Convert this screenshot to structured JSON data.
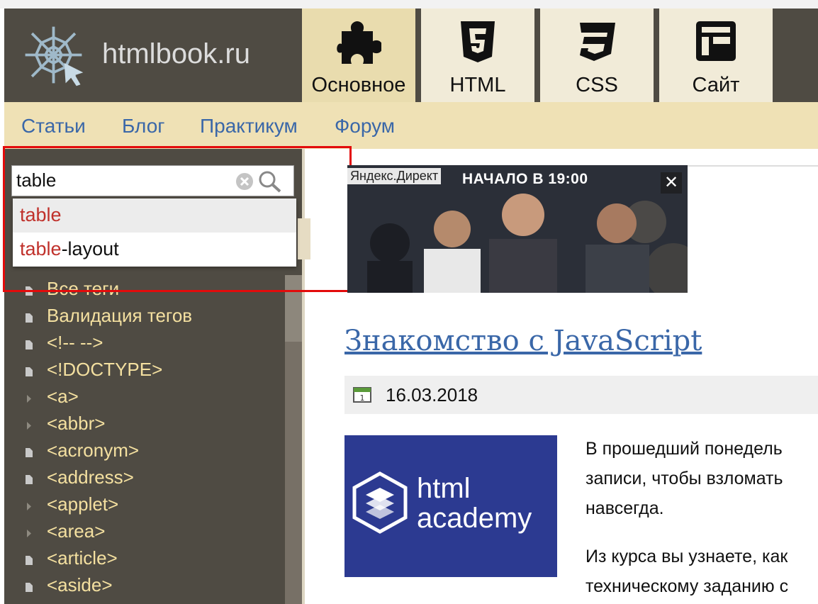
{
  "header": {
    "logo_text": "htmlbook.ru",
    "tabs": [
      {
        "label": "Основное",
        "icon": "puzzle-icon"
      },
      {
        "label": "HTML",
        "icon": "html5-icon"
      },
      {
        "label": "CSS",
        "icon": "css3-icon"
      },
      {
        "label": "Сайт",
        "icon": "layout-icon"
      }
    ],
    "active_tab": "Основное"
  },
  "subnav": {
    "items": [
      "Статьи",
      "Блог",
      "Практикум",
      "Форум"
    ]
  },
  "search": {
    "value": "table",
    "suggestions": [
      {
        "match": "table",
        "rest": ""
      },
      {
        "match": "table",
        "rest": "-layout"
      }
    ]
  },
  "sidebar": {
    "items": [
      "Все теги",
      "Валидация тегов",
      "<!-- -->",
      "<!DOCTYPE>",
      "<a>",
      "<abbr>",
      "<acronym>",
      "<address>",
      "<applet>",
      "<area>",
      "<article>",
      "<aside>"
    ],
    "item_icons": [
      "doc-icon",
      "doc-icon",
      "doc-icon",
      "doc-icon",
      "arrow-icon",
      "arrow-icon",
      "doc-icon",
      "doc-icon",
      "arrow-icon",
      "arrow-icon",
      "doc-icon",
      "doc-icon"
    ]
  },
  "ad": {
    "label": "Яндекс.Директ",
    "banner_text": "НАЧАЛО В 19:00",
    "close": "✕"
  },
  "article": {
    "title": "Знакомство с JavaScript",
    "date": "16.03.2018",
    "thumb_text_line1": "html",
    "thumb_text_line2": "academy",
    "para1_lines": [
      "В прошедший понедель",
      "записи, чтобы взломать",
      "навсегда."
    ],
    "para2_lines": [
      "Из курса вы узнаете, как",
      "техническому заданию с"
    ]
  },
  "colors": {
    "header_bg": "#4f4b43",
    "active_tab": "#e9dcae",
    "link": "#3a67a8",
    "highlight": "#c0312b",
    "tag_text": "#f4e0a0"
  }
}
